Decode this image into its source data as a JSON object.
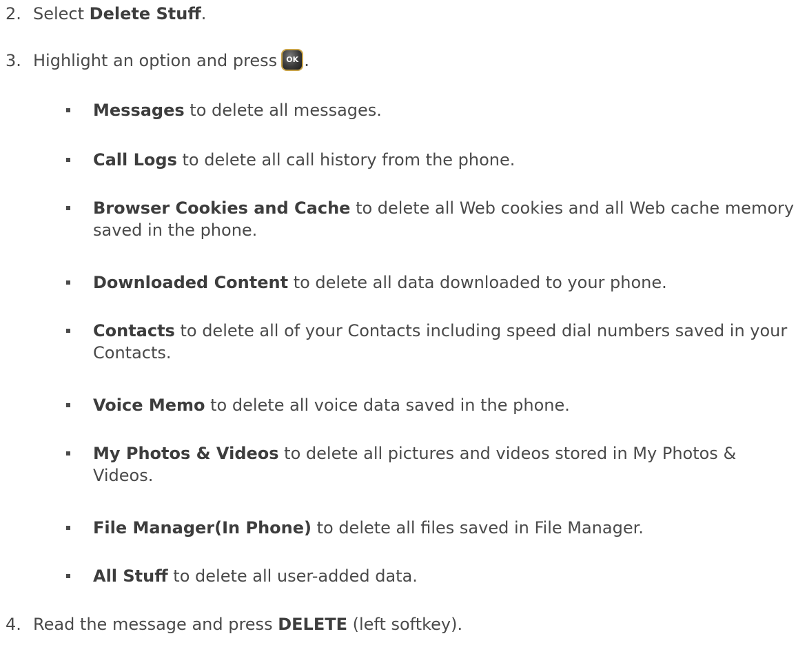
{
  "steps": [
    {
      "num": "2.",
      "pre": "Select ",
      "bold": "Delete Stuff",
      "post": "."
    },
    {
      "num": "3.",
      "pre": "Highlight an option and press",
      "key_label": "OK",
      "post": "."
    },
    {
      "num": "4.",
      "pre": "Read the message and press ",
      "bold": "DELETE",
      "post": " (left softkey)."
    }
  ],
  "options": [
    {
      "bold": "Messages",
      "text": " to delete all messages."
    },
    {
      "bold": "Call Logs",
      "text": " to delete all call history from the phone."
    },
    {
      "bold": "Browser Cookies and Cache",
      "text": " to delete all Web cookies and all Web cache memory saved in the phone."
    },
    {
      "bold": "Downloaded Content",
      "text": " to delete all data downloaded to your phone."
    },
    {
      "bold": "Contacts",
      "text": " to delete all of your Contacts including speed dial numbers saved in your Contacts."
    },
    {
      "bold": "Voice Memo",
      "text": " to delete all voice data saved in the phone."
    },
    {
      "bold": "My Photos & Videos",
      "text": " to delete all pictures and videos stored in My Photos & Videos."
    },
    {
      "bold": "File Manager(In Phone)",
      "text": " to delete all files saved in File Manager."
    },
    {
      "bold": "All Stuff",
      "text": " to delete all user-added data."
    }
  ]
}
